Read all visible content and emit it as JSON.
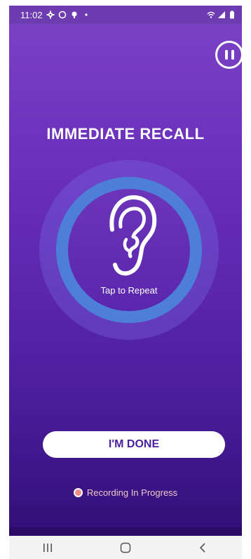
{
  "status_bar": {
    "time": "11:02",
    "icons": [
      "settings-icon",
      "circle-icon",
      "location-pin-icon",
      "dot-icon"
    ],
    "right_icons": [
      "wifi-icon",
      "signal-icon",
      "battery-icon"
    ]
  },
  "screen": {
    "title": "IMMEDIATE RECALL",
    "tap_label": "Tap to Repeat",
    "done_button": "I'M DONE",
    "recording_label": "Recording In Progress"
  },
  "colors": {
    "background_top": "#7a40c4",
    "background_bottom": "#32107a",
    "ring_blue": "#4d7fd8",
    "button_text": "#4a1fa0",
    "recording_dot": "#f08a8a"
  },
  "nav": {
    "icons": [
      "recent-apps-icon",
      "home-icon",
      "back-icon"
    ]
  }
}
